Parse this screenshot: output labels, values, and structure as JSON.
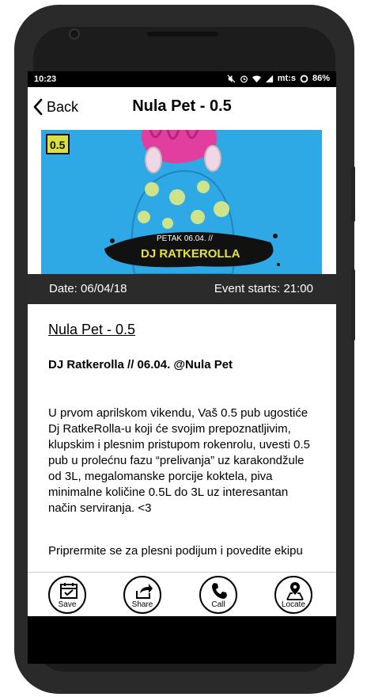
{
  "status_bar": {
    "time": "10:23",
    "network": "mt:s",
    "battery": "86%",
    "icons": [
      "mute-icon",
      "alarm-icon",
      "wifi-icon",
      "signal-icon",
      "data-sync-icon"
    ]
  },
  "nav": {
    "back_label": "Back",
    "title": "Nula Pet - 0.5"
  },
  "banner": {
    "badge": "0.5",
    "kicker": "PETAK 06.04. //",
    "headline": "DJ RATKEROLLA",
    "colors": {
      "background": "#2fa8e6",
      "badge": "#d8e23b",
      "hair": "#e23ea0"
    }
  },
  "event_info": {
    "date": "Date: 06/04/18",
    "starts": "Event starts: 21:00"
  },
  "article": {
    "heading": "Nula Pet - 0.5",
    "subtitle": "DJ Ratkerolla // 06.04. @Nula Pet",
    "paragraph1": "U prvom aprilskom vikendu, Vaš 0.5 pub ugostiće Dj RatkeRolla-u koji će svojim prepoznatljivim, klupskim i plesnim pristupom rokenrolu, uvesti 0.5 pub u prolećnu fazu “prelivanja” uz karakondžule od 3L, megalomanske porcije koktela, piva minimalne količine 0.5L do 3L uz interesantan način serviranja. <3",
    "paragraph2": "Priprermite se za plesni podijum i povedite ekipu"
  },
  "toolbar": {
    "save_label": "Save",
    "share_label": "Share",
    "call_label": "Call",
    "locate_label": "Locate"
  }
}
